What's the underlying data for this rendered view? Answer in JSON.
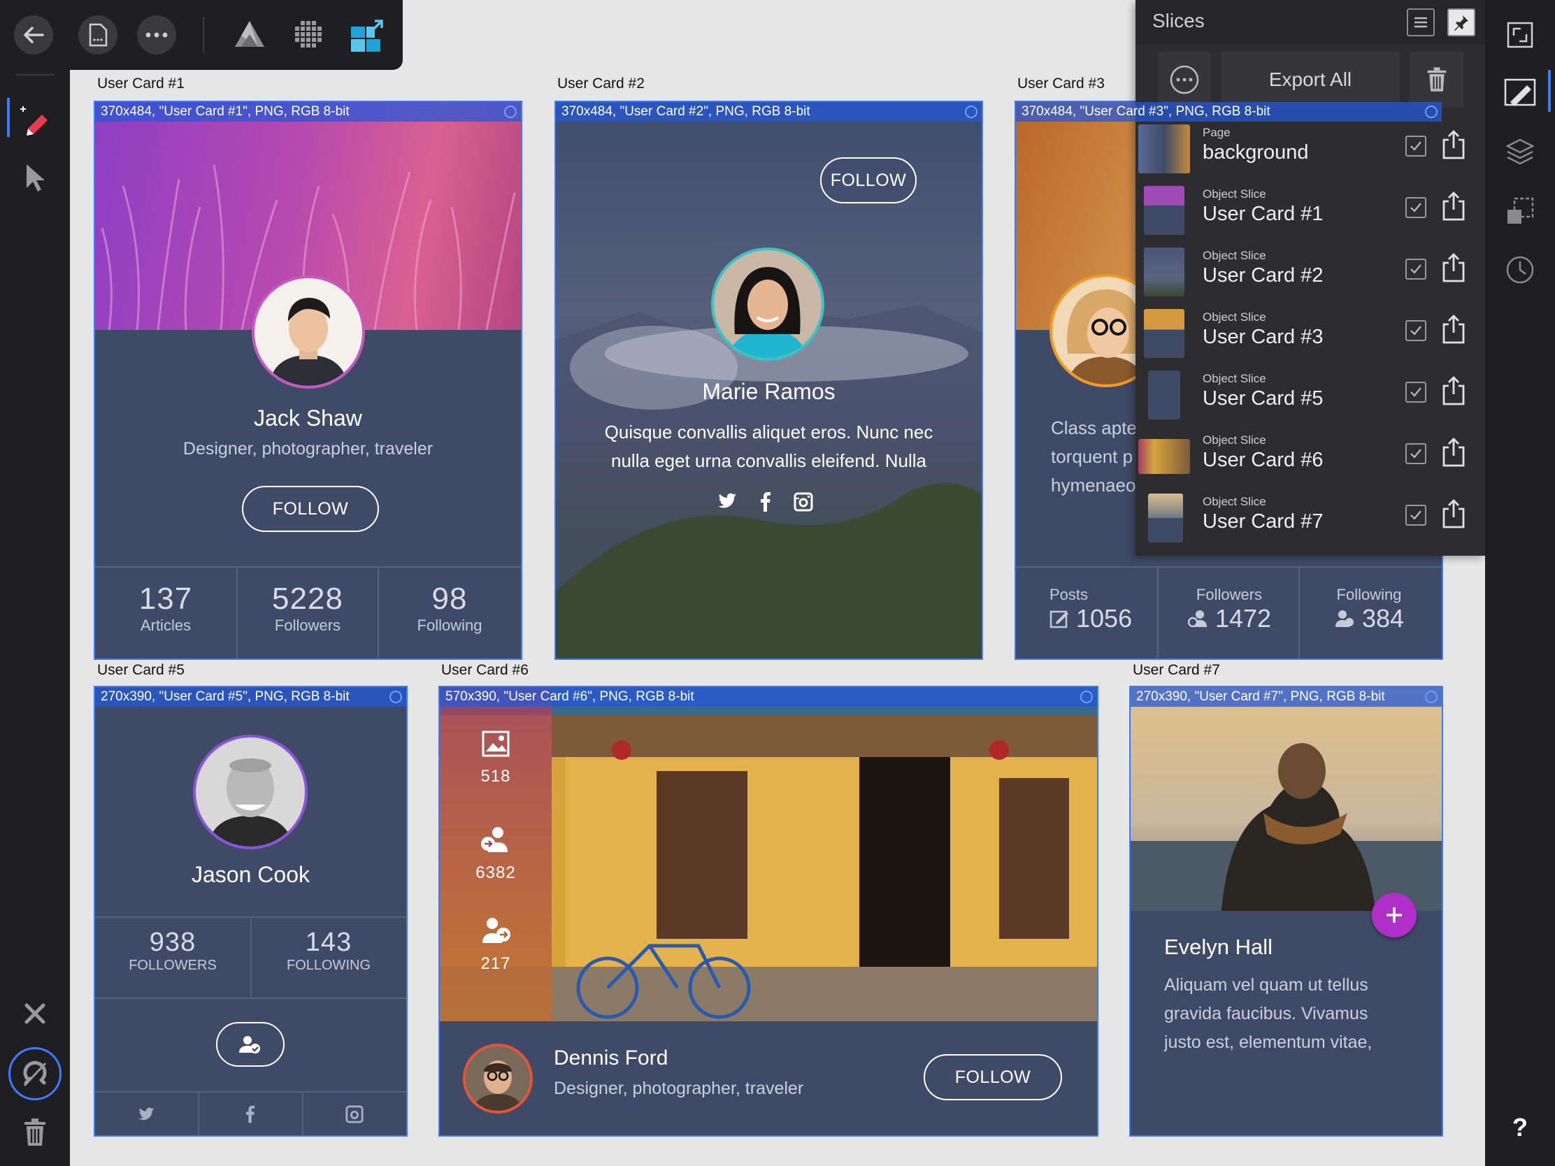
{
  "toolbar": {
    "icons": [
      "back-arrow-icon",
      "document-icon",
      "more-icon",
      "designer-persona-icon",
      "pixel-persona-icon",
      "export-persona-icon"
    ]
  },
  "cards": {
    "c1": {
      "label": "User Card #1",
      "slice": "370x484, \"User Card #1\", PNG, RGB 8-bit",
      "name": "Jack Shaw",
      "bio": "Designer, photographer, traveler",
      "follow": "FOLLOW",
      "stats": [
        {
          "n": "137",
          "t": "Articles"
        },
        {
          "n": "5228",
          "t": "Followers"
        },
        {
          "n": "98",
          "t": "Following"
        }
      ]
    },
    "c2": {
      "label": "User Card #2",
      "slice": "370x484, \"User Card #2\", PNG, RGB 8-bit",
      "name": "Marie Ramos",
      "bio_line1": "Quisque convallis aliquet eros. Nunc nec",
      "bio_line2": "nulla eget urna convallis eleifend. Nulla",
      "follow": "FOLLOW"
    },
    "c3": {
      "label": "User Card #3",
      "slice": "370x484, \"User Card #3\", PNG, RGB 8-bit",
      "text_line1": "Class apte",
      "text_line2": "torquent p",
      "text_line3": "hymenaeo",
      "stats": [
        {
          "t": "Posts",
          "n": "1056"
        },
        {
          "t": "Followers",
          "n": "1472"
        },
        {
          "t": "Following",
          "n": "384"
        }
      ]
    },
    "c5": {
      "label": "User Card #5",
      "slice": "270x390, \"User Card #5\", PNG, RGB 8-bit",
      "name": "Jason Cook",
      "stats": [
        {
          "n": "938",
          "t": "FOLLOWERS"
        },
        {
          "n": "143",
          "t": "FOLLOWING"
        }
      ]
    },
    "c6": {
      "label": "User Card #6",
      "slice": "570x390, \"User Card #6\", PNG, RGB 8-bit",
      "name": "Dennis Ford",
      "bio": "Designer, photographer, traveler",
      "follow": "FOLLOW",
      "stats": [
        "518",
        "6382",
        "217"
      ]
    },
    "c7": {
      "label": "User Card #7",
      "slice": "270x390, \"User Card #7\", PNG, RGB 8-bit",
      "name": "Evelyn Hall",
      "bio_line1": "Aliquam vel quam ut tellus",
      "bio_line2": "gravida faucibus. Vivamus",
      "bio_line3": "justo est, elementum vitae,"
    }
  },
  "slices_panel": {
    "title": "Slices",
    "export_all": "Export All",
    "rows": [
      {
        "kind": "Page",
        "name": "background",
        "checked": true
      },
      {
        "kind": "Object Slice",
        "name": "User Card #1",
        "checked": true
      },
      {
        "kind": "Object Slice",
        "name": "User Card #2",
        "checked": true
      },
      {
        "kind": "Object Slice",
        "name": "User Card #3",
        "checked": true
      },
      {
        "kind": "Object Slice",
        "name": "User Card #5",
        "checked": true
      },
      {
        "kind": "Object Slice",
        "name": "User Card #6",
        "checked": true
      },
      {
        "kind": "Object Slice",
        "name": "User Card #7",
        "checked": true
      }
    ]
  },
  "help": "?"
}
